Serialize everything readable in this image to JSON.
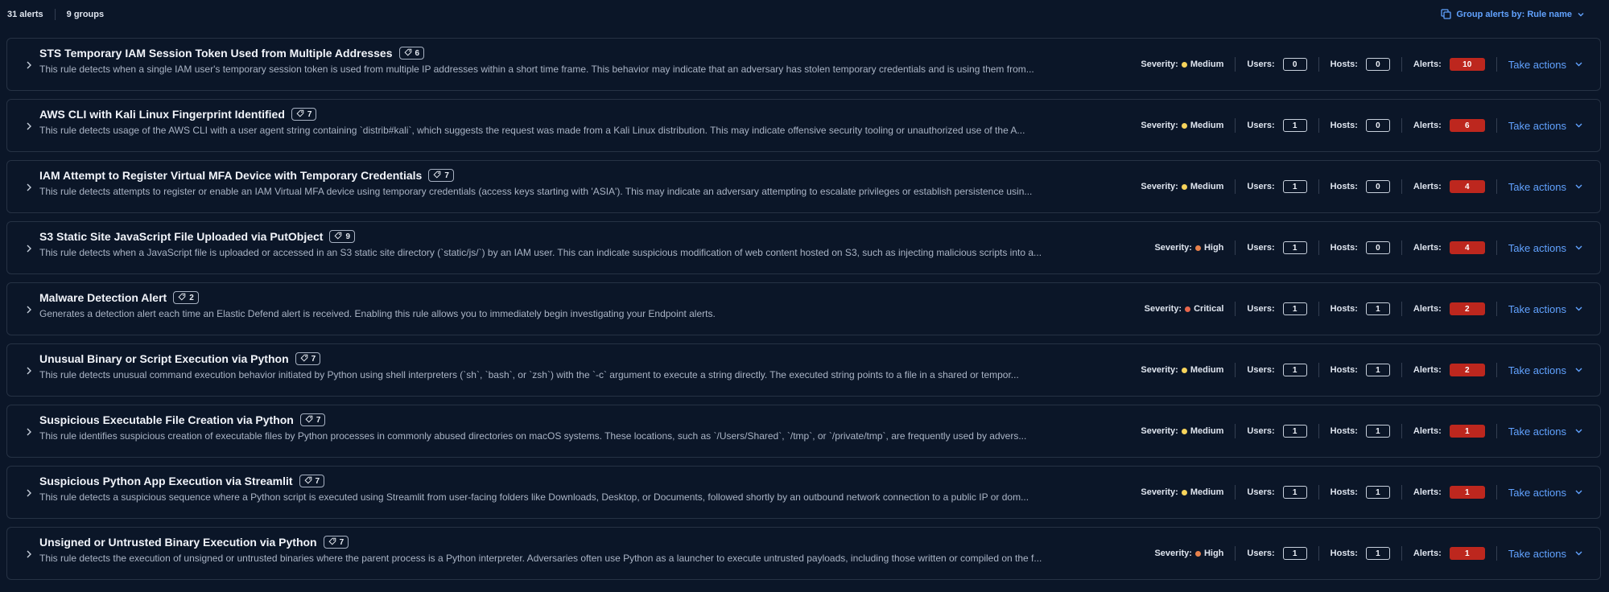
{
  "header": {
    "alerts_count": "31 alerts",
    "groups_count": "9 groups",
    "group_by_label": "Group alerts by: Rule name",
    "group_by_icon": "group-by-icon"
  },
  "labels": {
    "severity": "Severity:",
    "users": "Users:",
    "hosts": "Hosts:",
    "alerts": "Alerts:",
    "take_actions": "Take actions"
  },
  "severity_colors": {
    "Medium": "#f6d35b",
    "High": "#e7814c",
    "Critical": "#e7664c"
  },
  "groups": [
    {
      "title": "STS Temporary IAM Session Token Used from Multiple Addresses",
      "tag_count": "6",
      "description": "This rule detects when a single IAM user's temporary session token is used from multiple IP addresses within a short time frame. This behavior may indicate that an adversary has stolen temporary credentials and is using them from...",
      "severity": "Medium",
      "users": "0",
      "hosts": "0",
      "alerts": "10"
    },
    {
      "title": "AWS CLI with Kali Linux Fingerprint Identified",
      "tag_count": "7",
      "description": "This rule detects usage of the AWS CLI with a user agent string containing `distrib#kali`, which suggests the request was made from a Kali Linux distribution. This may indicate offensive security tooling or unauthorized use of the A...",
      "severity": "Medium",
      "users": "1",
      "hosts": "0",
      "alerts": "6"
    },
    {
      "title": "IAM Attempt to Register Virtual MFA Device with Temporary Credentials",
      "tag_count": "7",
      "description": "This rule detects attempts to register or enable an IAM Virtual MFA device using temporary credentials (access keys starting with 'ASIA'). This may indicate an adversary attempting to escalate privileges or establish persistence usin...",
      "severity": "Medium",
      "users": "1",
      "hosts": "0",
      "alerts": "4"
    },
    {
      "title": "S3 Static Site JavaScript File Uploaded via PutObject",
      "tag_count": "9",
      "description": "This rule detects when a JavaScript file is uploaded or accessed in an S3 static site directory (`static/js/`) by an IAM user. This can indicate suspicious modification of web content hosted on S3, such as injecting malicious scripts into a...",
      "severity": "High",
      "users": "1",
      "hosts": "0",
      "alerts": "4"
    },
    {
      "title": "Malware Detection Alert",
      "tag_count": "2",
      "description": "Generates a detection alert each time an Elastic Defend alert is received. Enabling this rule allows you to immediately begin investigating your Endpoint alerts.",
      "severity": "Critical",
      "users": "1",
      "hosts": "1",
      "alerts": "2"
    },
    {
      "title": "Unusual Binary or Script Execution via Python",
      "tag_count": "7",
      "description": "This rule detects unusual command execution behavior initiated by Python using shell interpreters (`sh`, `bash`, or `zsh`) with the `-c` argument to execute a string directly. The executed string points to a file in a shared or tempor...",
      "severity": "Medium",
      "users": "1",
      "hosts": "1",
      "alerts": "2"
    },
    {
      "title": "Suspicious Executable File Creation via Python",
      "tag_count": "7",
      "description": "This rule identifies suspicious creation of executable files by Python processes in commonly abused directories on macOS systems. These locations, such as `/Users/Shared`, `/tmp`, or `/private/tmp`, are frequently used by advers...",
      "severity": "Medium",
      "users": "1",
      "hosts": "1",
      "alerts": "1"
    },
    {
      "title": "Suspicious Python App Execution via Streamlit",
      "tag_count": "7",
      "description": "This rule detects a suspicious sequence where a Python script is executed using Streamlit from user-facing folders like Downloads, Desktop, or Documents, followed shortly by an outbound network connection to a public IP or dom...",
      "severity": "Medium",
      "users": "1",
      "hosts": "1",
      "alerts": "1"
    },
    {
      "title": "Unsigned or Untrusted Binary Execution via Python",
      "tag_count": "7",
      "description": "This rule detects the execution of unsigned or untrusted binaries where the parent process is a Python interpreter. Adversaries often use Python as a launcher to execute untrusted payloads, including those written or compiled on the f...",
      "severity": "High",
      "users": "1",
      "hosts": "1",
      "alerts": "1"
    }
  ]
}
